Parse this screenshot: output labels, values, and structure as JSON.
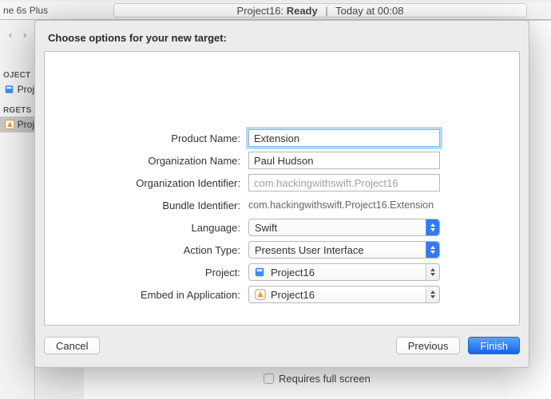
{
  "device_name": "ne 6s Plus",
  "status_bar": {
    "project": "Project16",
    "state": "Ready",
    "timestamp": "Today at 00:08"
  },
  "nav": {
    "section_project": "OJECT",
    "section_targets": "RGETS",
    "project_item": "Proj",
    "target_item": "Proj"
  },
  "under": {
    "requires_fullscreen_label": "Requires full screen"
  },
  "sheet": {
    "title": "Choose options for your new target:",
    "labels": {
      "product_name": "Product Name:",
      "organization_name": "Organization Name:",
      "organization_identifier": "Organization Identifier:",
      "bundle_identifier": "Bundle Identifier:",
      "language": "Language:",
      "action_type": "Action Type:",
      "project": "Project:",
      "embed": "Embed in Application:"
    },
    "values": {
      "product_name": "Extension",
      "organization_name": "Paul Hudson",
      "organization_identifier": "com.hackingwithswift.Project16",
      "bundle_identifier": "com.hackingwithswift.Project16.Extension",
      "language": "Swift",
      "action_type": "Presents User Interface",
      "project": "Project16",
      "embed": "Project16"
    },
    "buttons": {
      "cancel": "Cancel",
      "previous": "Previous",
      "finish": "Finish"
    }
  }
}
